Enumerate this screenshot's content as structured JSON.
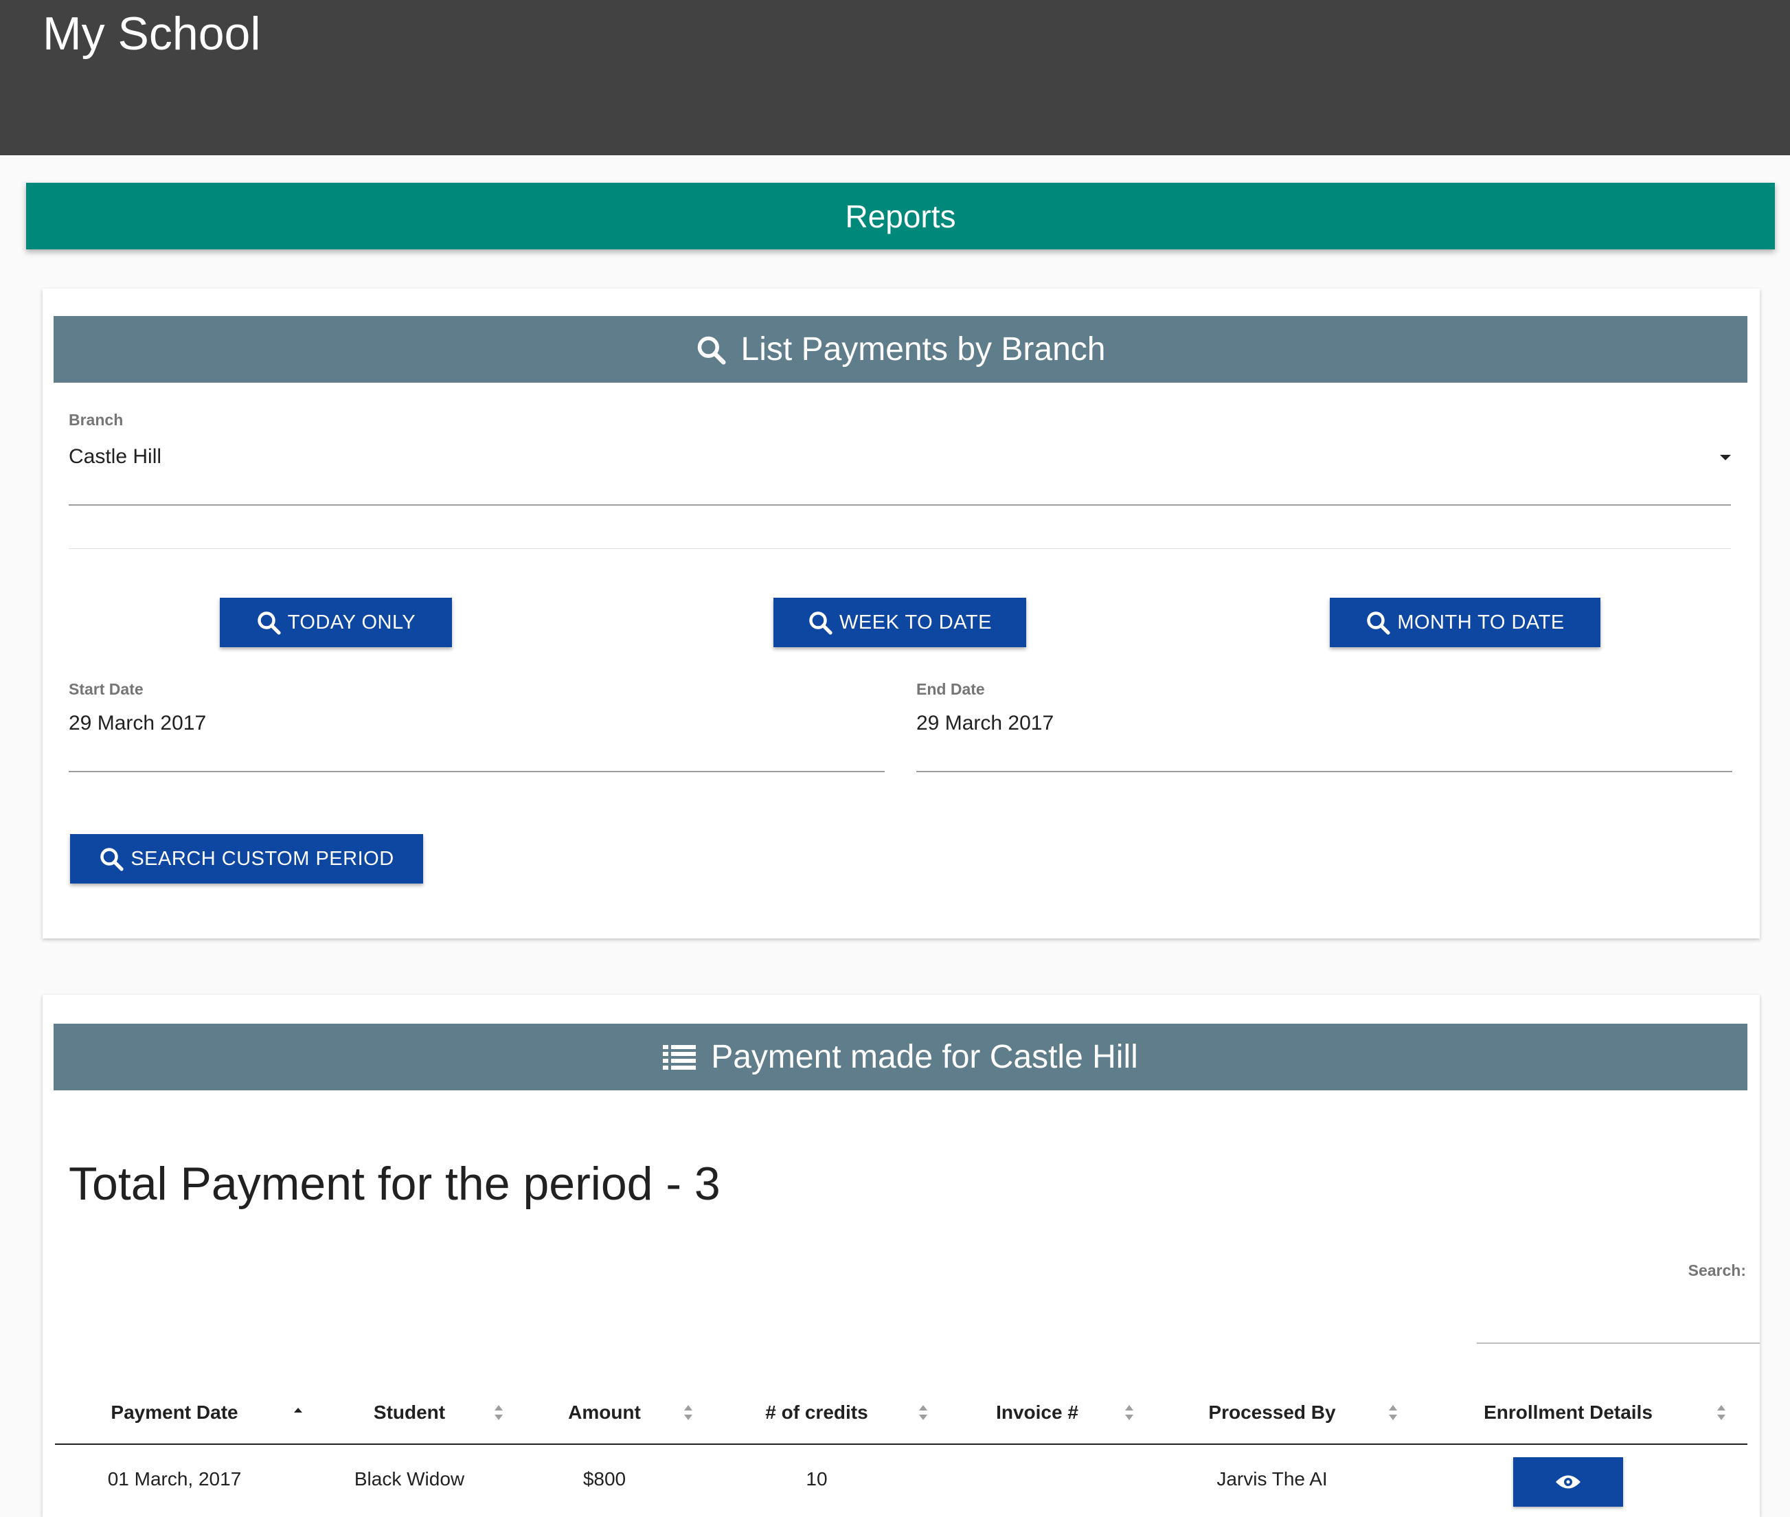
{
  "app": {
    "title": "My School"
  },
  "reports_bar": {
    "label": "Reports"
  },
  "filter_card": {
    "header": "List Payments by Branch",
    "branch": {
      "label": "Branch",
      "value": "Castle Hill"
    },
    "buttons": {
      "today": "TODAY ONLY",
      "week": "WEEK TO DATE",
      "month": "MONTH TO DATE",
      "custom": "SEARCH CUSTOM PERIOD"
    },
    "start_date": {
      "label": "Start Date",
      "value": "29 March 2017"
    },
    "end_date": {
      "label": "End Date",
      "value": "29 March 2017"
    }
  },
  "results_card": {
    "header": "Payment made for Castle Hill",
    "total": "Total Payment for the period - 3",
    "search": {
      "label": "Search:",
      "value": ""
    },
    "columns": [
      "Payment Date",
      "Student",
      "Amount",
      "# of credits",
      "Invoice #",
      "Processed By",
      "Enrollment Details"
    ],
    "rows": [
      {
        "payment_date": "01 March, 2017",
        "student": "Black Widow",
        "amount": "$800",
        "credits": "10",
        "invoice": "",
        "processed_by": "Jarvis The AI"
      }
    ]
  },
  "colors": {
    "topbar": "#424242",
    "reports": "#00897b",
    "card_header": "#607d8b",
    "button": "#0d47a1"
  }
}
